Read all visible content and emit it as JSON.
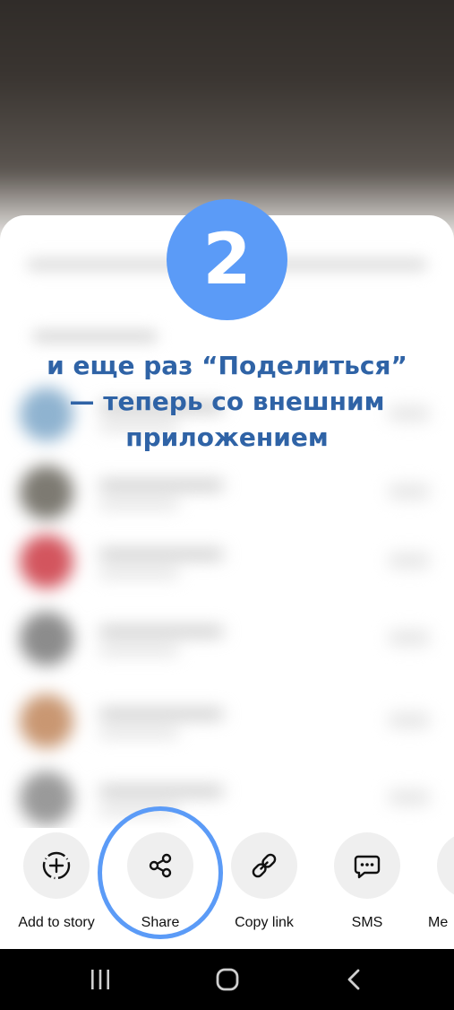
{
  "step": {
    "number": "2",
    "instruction_lines": [
      "и еще раз “Поделиться”",
      "— теперь со внешним",
      "приложением"
    ]
  },
  "share_actions": [
    {
      "label": "Add to story",
      "icon": "add-to-story-icon"
    },
    {
      "label": "Share",
      "icon": "share-icon"
    },
    {
      "label": "Copy link",
      "icon": "link-icon"
    },
    {
      "label": "SMS",
      "icon": "sms-icon"
    },
    {
      "label": "Me",
      "icon": "messenger-icon"
    }
  ],
  "nav": {
    "recents_icon": "recents-icon",
    "home_icon": "home-icon",
    "back_icon": "back-icon"
  },
  "colors": {
    "accent": "#5b9bf7",
    "instruction_text": "#2f63a6"
  }
}
